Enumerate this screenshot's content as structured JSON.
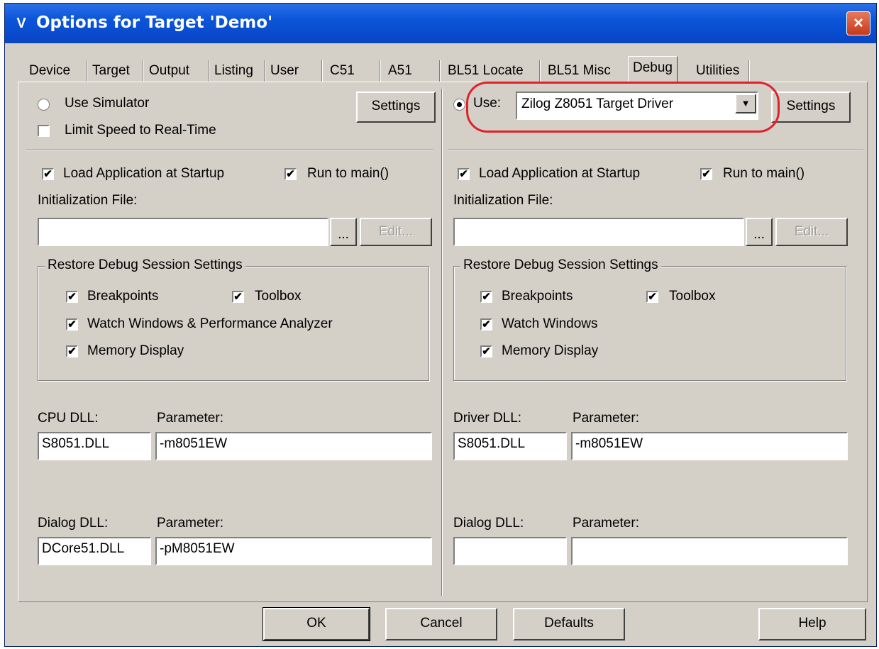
{
  "window": {
    "title": "Options for Target 'Demo'",
    "app_icon": "µV-icon",
    "close_glyph": "×"
  },
  "tabs": [
    {
      "label": "Device"
    },
    {
      "label": "Target"
    },
    {
      "label": "Output"
    },
    {
      "label": "Listing"
    },
    {
      "label": "User"
    },
    {
      "label": "C51"
    },
    {
      "label": "A51"
    },
    {
      "label": "BL51 Locate"
    },
    {
      "label": "BL51 Misc"
    },
    {
      "label": "Debug",
      "active": true
    },
    {
      "label": "Utilities"
    }
  ],
  "left": {
    "use_simulator_label": "Use Simulator",
    "use_simulator_selected": false,
    "limit_speed_label": "Limit Speed to Real-Time",
    "limit_speed_checked": false,
    "settings_label": "Settings",
    "load_app_label": "Load Application at Startup",
    "run_to_main_label": "Run to main()",
    "init_file_label": "Initialization File:",
    "init_file_value": "",
    "browse_label": "...",
    "edit_label": "Edit...",
    "restore_group_title": "Restore Debug Session Settings",
    "breakpoints_label": "Breakpoints",
    "toolbox_label": "Toolbox",
    "watch_label": "Watch Windows & Performance Analyzer",
    "memory_label": "Memory Display",
    "cpu_dll_label": "CPU DLL:",
    "cpu_param_label": "Parameter:",
    "cpu_dll_value": "S8051.DLL",
    "cpu_param_value": "-m8051EW",
    "dialog_dll_label": "Dialog DLL:",
    "dialog_param_label": "Parameter:",
    "dialog_dll_value": "DCore51.DLL",
    "dialog_param_value": "-pM8051EW"
  },
  "right": {
    "use_label": "Use:",
    "use_selected": true,
    "driver_select_value": "Zilog Z8051 Target Driver",
    "settings_label": "Settings",
    "load_app_label": "Load Application at Startup",
    "run_to_main_label": "Run to main()",
    "init_file_label": "Initialization File:",
    "init_file_value": "",
    "browse_label": "...",
    "edit_label": "Edit...",
    "restore_group_title": "Restore Debug Session Settings",
    "breakpoints_label": "Breakpoints",
    "toolbox_label": "Toolbox",
    "watch_label": "Watch Windows",
    "memory_label": "Memory Display",
    "driver_dll_label": "Driver DLL:",
    "driver_param_label": "Parameter:",
    "driver_dll_value": "S8051.DLL",
    "driver_param_value": "-m8051EW",
    "dialog_dll_label": "Dialog DLL:",
    "dialog_param_label": "Parameter:",
    "dialog_dll_value": "",
    "dialog_param_value": ""
  },
  "footer": {
    "ok_label": "OK",
    "cancel_label": "Cancel",
    "defaults_label": "Defaults",
    "help_label": "Help"
  },
  "check_glyph": "✔",
  "colors": {
    "titlebar": "#0a55d8",
    "dialog_bg": "#d4d0c8",
    "annotation_circle": "#e0202a",
    "close_button": "#c5391c"
  }
}
